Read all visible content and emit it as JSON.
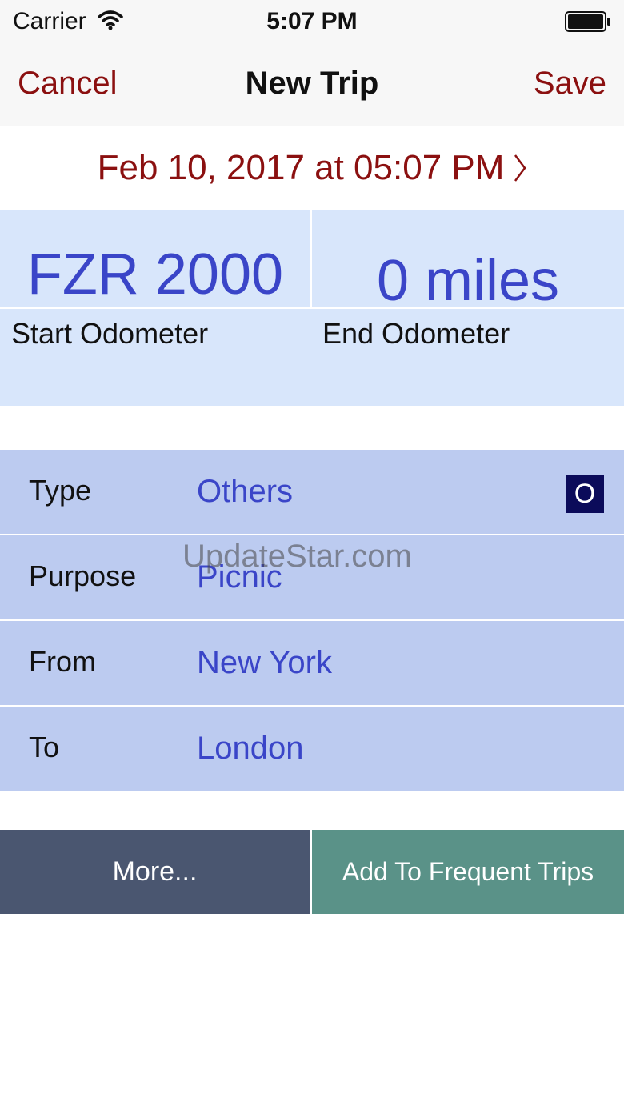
{
  "status_bar": {
    "carrier": "Carrier",
    "time": "5:07 PM",
    "wifi_icon": "wifi-icon",
    "battery_icon": "battery-icon"
  },
  "nav": {
    "cancel_label": "Cancel",
    "title": "New Trip",
    "save_label": "Save",
    "accent_color": "#8b1010"
  },
  "trip_date": {
    "text": "Feb 10, 2017 at 05:07 PM",
    "icon": "chevron-right-icon"
  },
  "odometer": {
    "start_value": "FZR 2000",
    "start_label": "Start Odometer",
    "end_value": "0 miles",
    "end_label": "End Odometer"
  },
  "fields": [
    {
      "label": "Type",
      "value": "Others",
      "badge": "O"
    },
    {
      "label": "Purpose",
      "value": "Picnic"
    },
    {
      "label": "From",
      "value": "New York"
    },
    {
      "label": "To",
      "value": "London"
    }
  ],
  "watermark": "UpdateStar.com",
  "buttons": {
    "more_label": "More...",
    "frequent_label": "Add To Frequent Trips"
  },
  "colors": {
    "value_text": "#3a45c8",
    "odometer_bg": "#d8e6fb",
    "field_bg": "#bccbf0",
    "more_bg": "#4a5670",
    "frequent_bg": "#5a9288"
  }
}
